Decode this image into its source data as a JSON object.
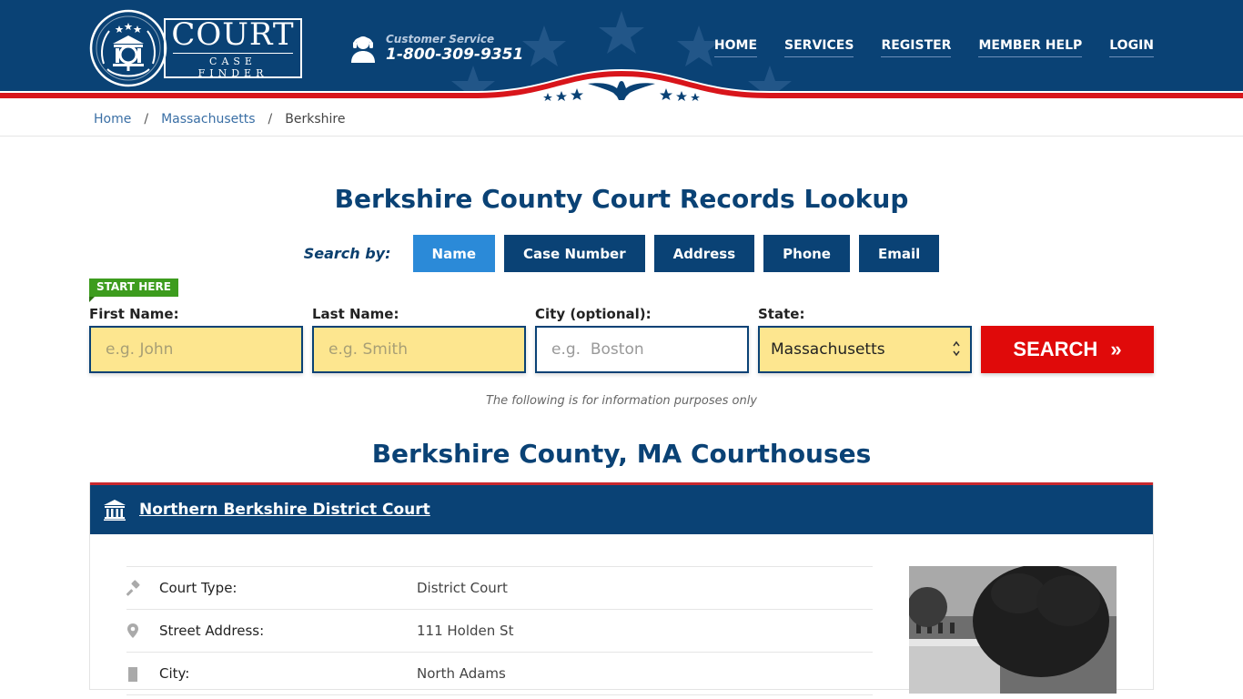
{
  "header": {
    "logo": {
      "title": "COURT",
      "subtitle": "CASE FINDER"
    },
    "customer_service": {
      "label": "Customer Service",
      "phone": "1-800-309-9351"
    },
    "nav": [
      {
        "label": "HOME"
      },
      {
        "label": "SERVICES"
      },
      {
        "label": "REGISTER"
      },
      {
        "label": "MEMBER HELP"
      },
      {
        "label": "LOGIN"
      }
    ]
  },
  "breadcrumb": [
    {
      "label": "Home"
    },
    {
      "label": "Massachusetts"
    },
    {
      "label": "Berkshire"
    }
  ],
  "page_title": "Berkshire County Court Records Lookup",
  "search": {
    "search_by_label": "Search by:",
    "tabs": [
      {
        "label": "Name",
        "active": true
      },
      {
        "label": "Case Number"
      },
      {
        "label": "Address"
      },
      {
        "label": "Phone"
      },
      {
        "label": "Email"
      }
    ],
    "start_here": "START HERE",
    "fields": {
      "first_name": {
        "label": "First Name:",
        "placeholder": "e.g. John",
        "value": ""
      },
      "last_name": {
        "label": "Last Name:",
        "placeholder": "e.g. Smith",
        "value": ""
      },
      "city": {
        "label": "City (optional):",
        "placeholder": "e.g.  Boston",
        "value": ""
      },
      "state": {
        "label": "State:",
        "value": "Massachusetts"
      }
    },
    "search_button": "SEARCH",
    "search_button_icon": "»"
  },
  "info_note": "The following is for information purposes only",
  "section_title": "Berkshire County, MA Courthouses",
  "courts": [
    {
      "name": "Northern Berkshire District Court",
      "details": [
        {
          "icon": "gavel-icon",
          "label": "Court Type:",
          "value": "District Court"
        },
        {
          "icon": "map-pin-icon",
          "label": "Street Address:",
          "value": "111 Holden St"
        },
        {
          "icon": "building-icon",
          "label": "City:",
          "value": "North Adams"
        }
      ]
    }
  ],
  "colors": {
    "brand_blue": "#0a4275",
    "active_tab": "#2b8ad8",
    "search_red": "#e00a0a",
    "input_yellow": "#fde68f",
    "start_green": "#3d9c1e",
    "accent_red": "#c8282e"
  }
}
